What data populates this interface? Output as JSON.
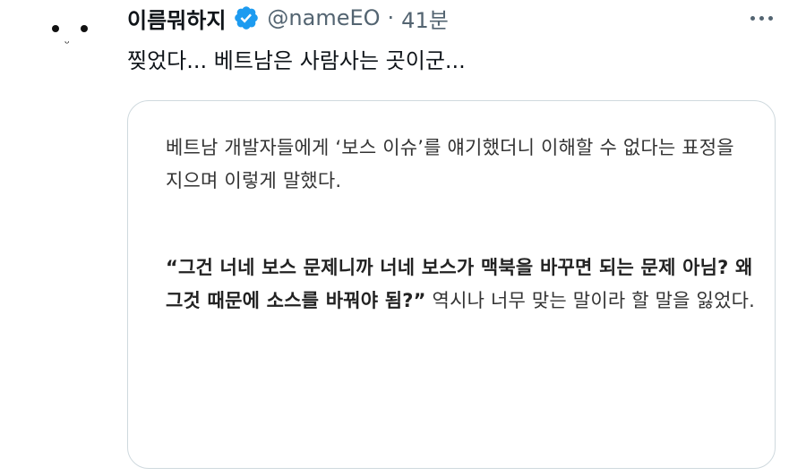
{
  "tweet": {
    "display_name": "이름뭐하지",
    "handle": "@nameEO",
    "separator": "·",
    "time": "41분",
    "text": "찢었다... 베트남은 사람사는 곳이군...",
    "verified_color": "#1d9bf0"
  },
  "media": {
    "paragraph1": "베트남 개발자들에게 ‘보스 이슈’를 얘기했더니 이해할 수 없다는 표정을 지으며 이렇게 말했다.",
    "quote_bold": "“그건 너네 보스 문제니까 너네 보스가 맥북을 바꾸면 되는 문제 아님? 왜 그것 때문에 소스를 바꿔야 됨?”",
    "quote_tail": " 역시나 너무 맞는 말이라 할 말을 잃었다."
  },
  "icons": {
    "verified": "verified-badge-icon",
    "more": "more-options-icon"
  }
}
